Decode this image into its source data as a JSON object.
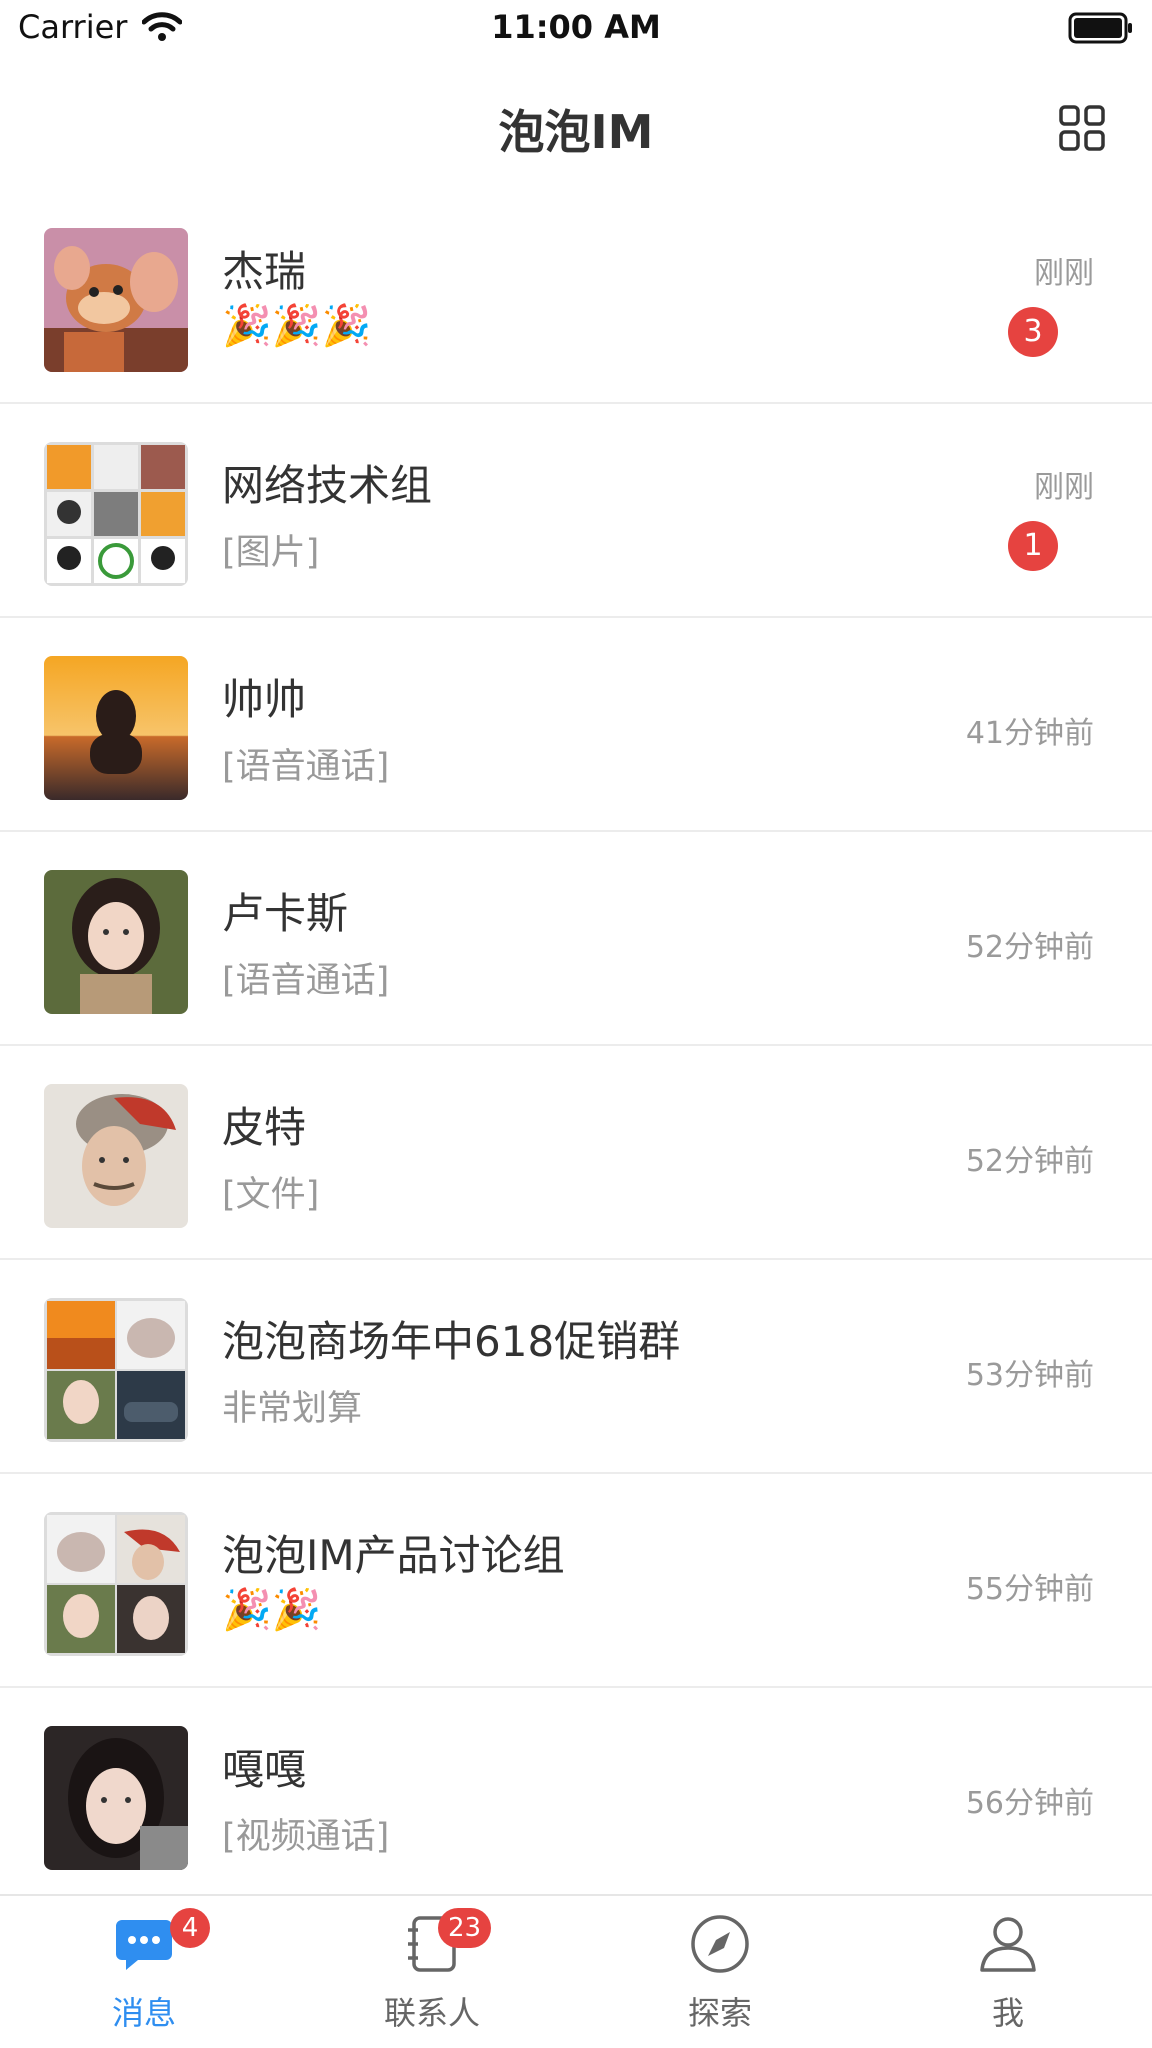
{
  "status_bar": {
    "carrier": "Carrier",
    "time": "11:00 AM"
  },
  "nav": {
    "title": "泡泡IM",
    "menu_icon": "grid-icon"
  },
  "conversations": [
    {
      "name": "杰瑞",
      "preview": "🎉🎉🎉",
      "time": "刚刚",
      "unread": "3"
    },
    {
      "name": "网络技术组",
      "preview": "[图片]",
      "time": "刚刚",
      "unread": "1"
    },
    {
      "name": "帅帅",
      "preview": "[语音通话]",
      "time": "41分钟前"
    },
    {
      "name": "卢卡斯",
      "preview": "[语音通话]",
      "time": "52分钟前"
    },
    {
      "name": "皮特",
      "preview": "[文件]",
      "time": "52分钟前"
    },
    {
      "name": "泡泡商场年中618促销群",
      "preview": "非常划算",
      "time": "53分钟前"
    },
    {
      "name": "泡泡IM产品讨论组",
      "preview": "🎉🎉",
      "time": "55分钟前"
    },
    {
      "name": "嘎嘎",
      "preview": "[视频通话]",
      "time": "56分钟前"
    }
  ],
  "tabbar": {
    "tabs": [
      {
        "label": "消息",
        "icon": "chat-bubble-icon",
        "badge": "4",
        "active": true
      },
      {
        "label": "联系人",
        "icon": "contacts-book-icon",
        "badge": "23"
      },
      {
        "label": "探索",
        "icon": "compass-icon"
      },
      {
        "label": "我",
        "icon": "person-icon"
      }
    ]
  },
  "colors": {
    "accent": "#2f8ef0",
    "badge": "#e64340",
    "secondary_text": "#999999"
  }
}
